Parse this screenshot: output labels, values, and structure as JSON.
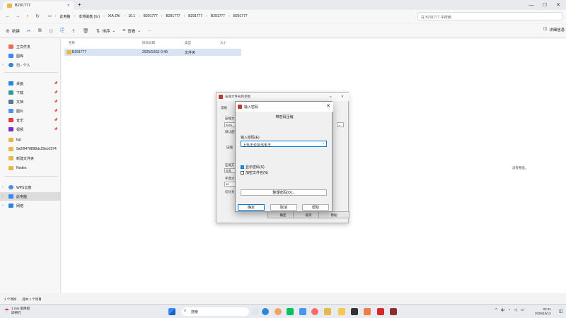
{
  "tab": {
    "title": "B291777",
    "close": "×",
    "new": "+"
  },
  "window_controls": {
    "minimize": "—",
    "maximize": "☐",
    "close": "✕"
  },
  "address": {
    "crumbs": [
      "此电脑",
      "本地磁盘 (G:)",
      "XIA ZAI",
      "10.1",
      "B291777",
      "B291777",
      "B291777",
      "B291777",
      "B291777"
    ],
    "search_placeholder": "在 B291777 中搜索"
  },
  "toolbar": {
    "new": "新建",
    "sort": "排序",
    "view": "查看",
    "more": "···",
    "details": "详细信息"
  },
  "sidebar": {
    "home": "主文件夹",
    "gallery": "图库",
    "cloud": "司 - 个人",
    "desktop": "桌面",
    "downloads": "下载",
    "documents": "文档",
    "pictures": "图片",
    "music": "音乐",
    "videos": "视频",
    "f1": "tup",
    "f2": "9a2f9478898dc29eb1974",
    "f3": "新建文件夹",
    "f4": "Nodes",
    "wps": "WPS云盘",
    "thispc": "此电脑",
    "network": "网络"
  },
  "columns": {
    "name": "名称",
    "date": "修改日期",
    "type": "类型",
    "size": "大小"
  },
  "files": [
    {
      "name": "B291777",
      "date": "2025/10/11 0:49",
      "type": "文件夹",
      "size": ""
    }
  ],
  "preview_text": "没有预览。",
  "status": {
    "count": "1 个项目",
    "selected": "选中 1 个项目"
  },
  "taskbar": {
    "weather_temp": "1 mm 雨降雨",
    "weather_desc": "即将行",
    "search": "搜索",
    "lang": "中",
    "time": "22:11",
    "date": "2025/10/13"
  },
  "dialog_back": {
    "title": "压缩文件名和参数",
    "tab": "常规",
    "label_name": "压缩文",
    "name_val": "B291",
    "label_default": "默认配",
    "label_format": "压缩",
    "label_method": "压缩方",
    "method_val": "标准",
    "label_dict": "字典大",
    "dict_val": "32",
    "label_split": "切分为",
    "help_q": "?",
    "ok": "确定",
    "cancel": "取消",
    "help": "帮助"
  },
  "dialog_password": {
    "title": "输入密码",
    "subtitle": "带密码压缩",
    "label": "输入密码(E)",
    "value": "上毛王论坛当毛王",
    "show_password": "显示密码(S)",
    "encrypt_names": "加密文件名(N)",
    "organize": "整理密码(O)...",
    "ok": "确定",
    "cancel": "取消",
    "help": "帮助"
  }
}
